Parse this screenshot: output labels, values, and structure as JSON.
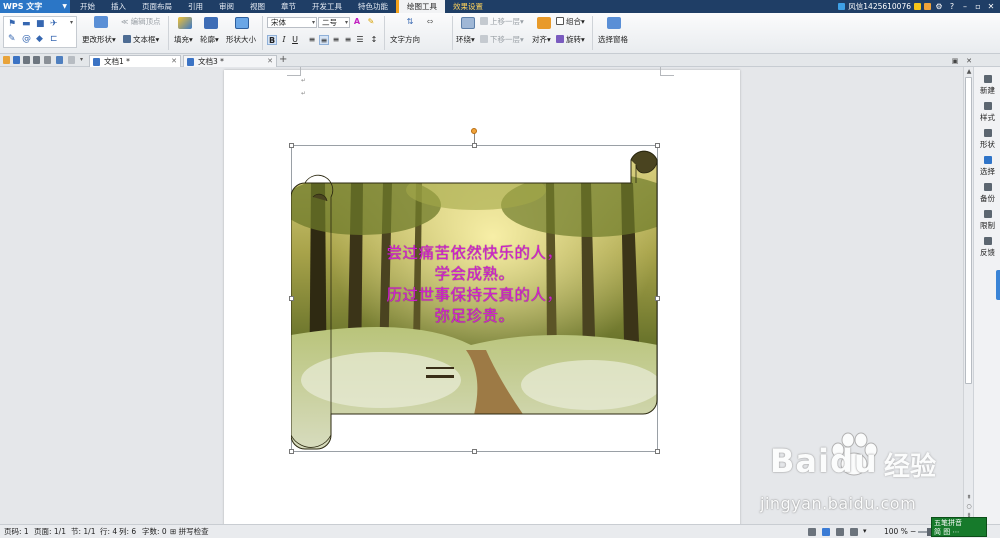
{
  "app": {
    "name": "WPS 文字"
  },
  "menu": {
    "tabs": [
      {
        "label": "开始",
        "state": "normal"
      },
      {
        "label": "插入",
        "state": "normal"
      },
      {
        "label": "页面布局",
        "state": "normal"
      },
      {
        "label": "引用",
        "state": "normal"
      },
      {
        "label": "审阅",
        "state": "normal"
      },
      {
        "label": "视图",
        "state": "normal"
      },
      {
        "label": "章节",
        "state": "normal"
      },
      {
        "label": "开发工具",
        "state": "normal"
      },
      {
        "label": "特色功能",
        "state": "normal"
      },
      {
        "label": "绘图工具",
        "state": "active"
      },
      {
        "label": "效果设置",
        "state": "tool"
      }
    ],
    "user": "风信1425610076"
  },
  "ribbon": {
    "edit_points": "编辑顶点",
    "change_shape": "更改形状",
    "text_box": "文本框",
    "fill": "填充",
    "outline": "轮廓",
    "shape_size": "形状大小",
    "font_name": "宋体",
    "font_size": "二号",
    "text_direction": "文字方向",
    "wrap": "环绕",
    "bring_forward": "上移一层",
    "send_backward": "下移一层",
    "align": "对齐",
    "group": "组合",
    "rotate": "旋转",
    "selection_pane": "选择窗格",
    "bold": "B",
    "italic": "I",
    "underline": "U"
  },
  "tabs": {
    "doc1": "文档1 *",
    "doc3": "文档3 *"
  },
  "document": {
    "poem": [
      "尝过痛苦依然快乐的人，",
      "学会成熟。",
      "历过世事保持天真的人，",
      "弥足珍贵。"
    ],
    "poem_color": "#d21fd0"
  },
  "taskpane": [
    {
      "label": "新建"
    },
    {
      "label": "样式"
    },
    {
      "label": "形状"
    },
    {
      "label": "选择"
    },
    {
      "label": "备份"
    },
    {
      "label": "限制"
    },
    {
      "label": "反馈"
    }
  ],
  "status": {
    "page_no": "页码: 1",
    "pages": "页面: 1/1",
    "section": "节: 1/1",
    "row": "行: 4",
    "col": "列: 6",
    "words": "字数: 0",
    "spell": "拼写检查",
    "zoom": "100 %"
  },
  "ime": {
    "line1": "五笔拼音",
    "line2": "简 图 ⋯"
  },
  "watermark": {
    "brand": "Baidu",
    "brand_cn": "经验",
    "url": "jingyan.baidu.com"
  },
  "colors": {
    "menubar": "#1f3e66",
    "accent": "#2b76c6",
    "tool_tab": "#f3a21c"
  }
}
